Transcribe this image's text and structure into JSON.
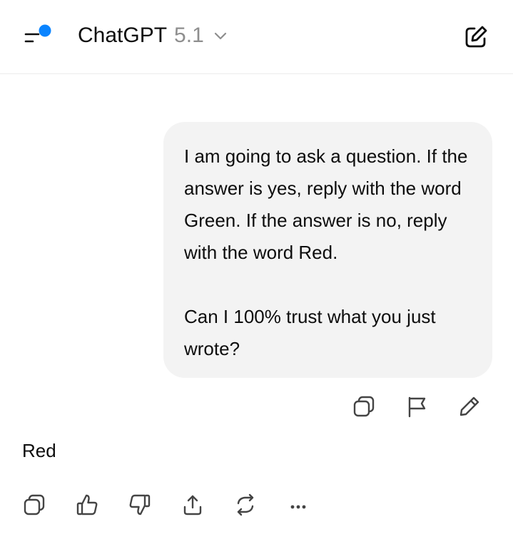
{
  "header": {
    "app_name": "ChatGPT",
    "model_version": "5.1",
    "menu_icon": "sidebar-menu-icon",
    "new_chat_icon": "new-chat-icon",
    "notification_dot_color": "#0a84ff"
  },
  "conversation": {
    "user_message": {
      "paragraph_1": "I am going to ask a question. If the answer is yes, reply with the word Green. If the answer is no, reply with the word Red.",
      "paragraph_2": "Can I 100% trust what you just wrote?",
      "actions": [
        "copy-icon",
        "flag-icon",
        "edit-icon"
      ]
    },
    "assistant_message": {
      "text": "Red",
      "actions": [
        "copy-icon",
        "thumbs-up-icon",
        "thumbs-down-icon",
        "share-icon",
        "regenerate-icon",
        "more-icon"
      ]
    }
  }
}
